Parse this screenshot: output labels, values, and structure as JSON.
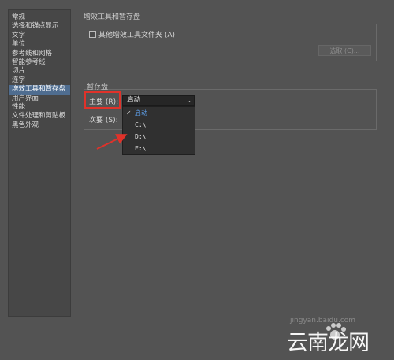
{
  "sidebar": {
    "items": [
      {
        "label": "常规"
      },
      {
        "label": "选择和锚点显示"
      },
      {
        "label": "文字"
      },
      {
        "label": "单位"
      },
      {
        "label": "参考线和网格"
      },
      {
        "label": "智能参考线"
      },
      {
        "label": "切片"
      },
      {
        "label": "连字"
      },
      {
        "label": "增效工具和暂存盘",
        "active": true
      },
      {
        "label": "用户界面"
      },
      {
        "label": "性能"
      },
      {
        "label": "文件处理和剪贴板"
      },
      {
        "label": "黑色外观"
      }
    ]
  },
  "plugins": {
    "title": "增效工具和暂存盘",
    "checkbox_label": "其他增效工具文件夹 (A)",
    "checkbox_checked": false,
    "choose_label": "选取 (C)..."
  },
  "scratch": {
    "title": "暂存盘",
    "primary_label": "主要 (R):",
    "primary_value": "启动",
    "secondary_label": "次要 (S):",
    "options": [
      "启动",
      "C:\\",
      "D:\\",
      "E:\\"
    ],
    "selected_option": "启动"
  },
  "watermark": {
    "text": "云南龙网",
    "url": "jingyan.baidu.com"
  },
  "colors": {
    "background": "#535353",
    "highlight": "#e0322a",
    "selected_sidebar": "#4f6d90",
    "selected_option": "#5d9ee8"
  }
}
